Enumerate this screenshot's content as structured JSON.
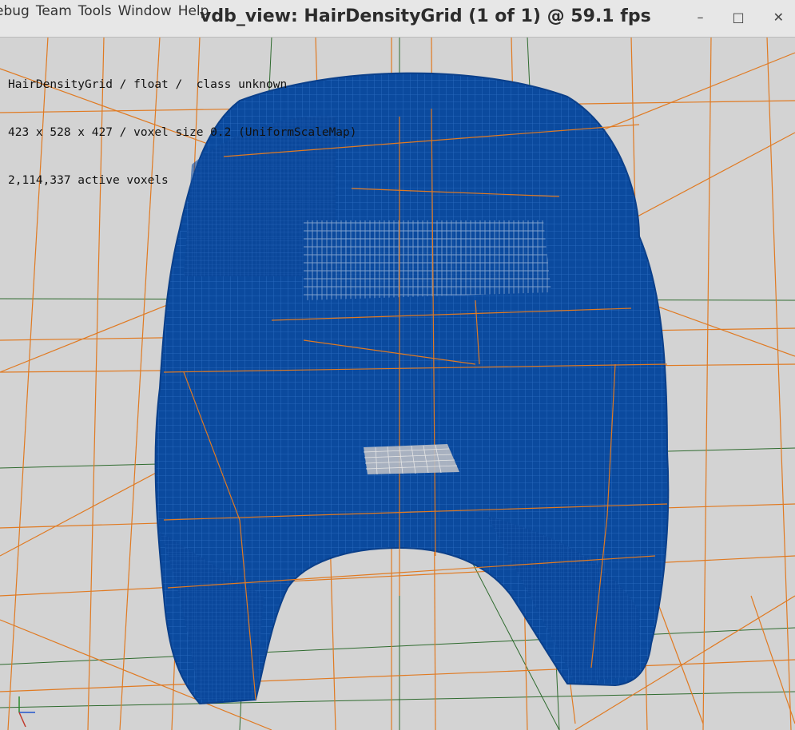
{
  "window": {
    "title": "vdb_view: HairDensityGrid (1 of 1) @ 59.1 fps",
    "controls": {
      "minimize": "–",
      "maximize": "□",
      "close": "✕"
    }
  },
  "menubar": {
    "items": [
      {
        "label": "ebug"
      },
      {
        "label": "Team"
      },
      {
        "label": "Tools"
      },
      {
        "label": "Window"
      },
      {
        "label": "Help"
      }
    ]
  },
  "hud": {
    "line1": "HairDensityGrid / float /  class unknown",
    "line2": "423 x 528 x 427 / voxel size 0.2 (UniformScaleMap)",
    "line3": "2,114,337 active voxels"
  },
  "colors": {
    "background": "#d3d3d3",
    "voxel": "#0a4aa0",
    "grid_orange": "#e07a22",
    "grid_green": "#2f6b2f",
    "axis_red": "#c0392b",
    "axis_green": "#2a8a2a",
    "axis_blue": "#2255cc"
  }
}
